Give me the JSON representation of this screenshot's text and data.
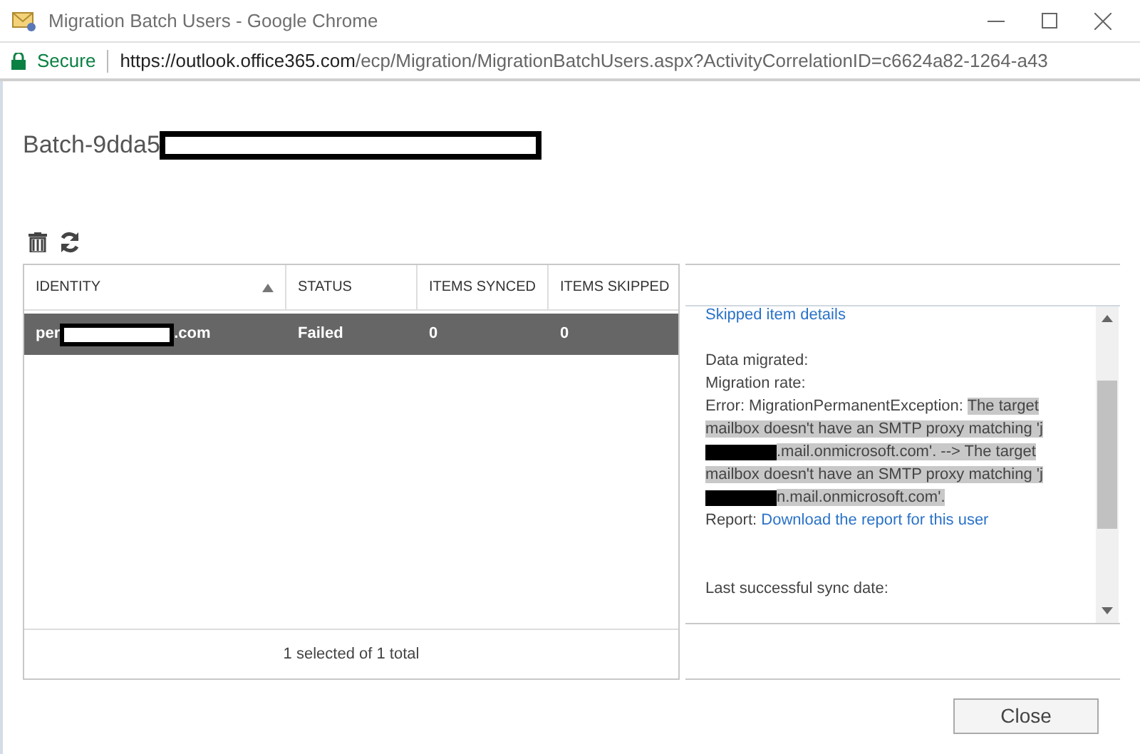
{
  "window": {
    "title": "Migration Batch Users - Google Chrome"
  },
  "address_bar": {
    "security": "Secure",
    "url_host": "https://outlook.office365.com",
    "url_path": "/ecp/Migration/MigrationBatchUsers.aspx?ActivityCorrelationID=c6624a82-1264-a43"
  },
  "page_title": {
    "segments": [
      {
        "kind": "text",
        "text": "Batch-9dda5"
      },
      {
        "kind": "redaction"
      }
    ]
  },
  "table": {
    "columns": [
      {
        "label": "IDENTITY",
        "sorted": true
      },
      {
        "label": "STATUS",
        "sorted": false
      },
      {
        "label": "ITEMS SYNCED",
        "sorted": false
      },
      {
        "label": "ITEMS SKIPPED",
        "sorted": false
      }
    ],
    "rows": [
      {
        "selected": true,
        "identity": [
          {
            "kind": "text",
            "text": "per"
          },
          {
            "kind": "redaction"
          },
          {
            "kind": "text",
            "text": ".com"
          }
        ],
        "status": "Failed",
        "items_synced": "0",
        "items_skipped": "0"
      }
    ],
    "footer": "1 selected of 1 total"
  },
  "details": {
    "link_top": "Skipped item details",
    "lines": [
      {
        "kind": "blank"
      },
      {
        "kind": "text",
        "segments": [
          {
            "kind": "text",
            "text": "Data migrated:",
            "highlighted": false
          }
        ]
      },
      {
        "kind": "text",
        "segments": [
          {
            "kind": "text",
            "text": "Migration rate:",
            "highlighted": false
          }
        ]
      },
      {
        "kind": "text",
        "segments": [
          {
            "kind": "text",
            "text": "Error: MigrationPermanentException: ",
            "highlighted": false
          },
          {
            "kind": "text",
            "text": "The target mailbox doesn't have an SMTP proxy matching 'j",
            "highlighted": true
          },
          {
            "kind": "redaction"
          },
          {
            "kind": "text",
            "text": ".mail.onmicrosoft.com'. --> The target mailbox doesn't have an SMTP proxy matching 'j",
            "highlighted": true
          },
          {
            "kind": "redaction"
          },
          {
            "kind": "text",
            "text": "n.mail.onmicrosoft.com'.",
            "highlighted": true
          }
        ]
      },
      {
        "kind": "link",
        "label": "Report: ",
        "link": "Download the report for this user"
      },
      {
        "kind": "blank"
      },
      {
        "kind": "blank"
      },
      {
        "kind": "text",
        "segments": [
          {
            "kind": "text",
            "text": "Last successful sync date:",
            "highlighted": false
          }
        ]
      }
    ]
  },
  "buttons": [
    {
      "label": "Close"
    }
  ]
}
